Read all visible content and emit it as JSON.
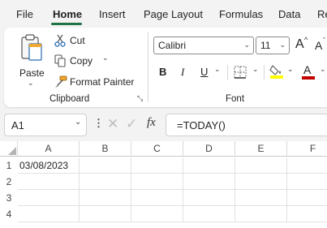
{
  "tabs": [
    "File",
    "Home",
    "Insert",
    "Page Layout",
    "Formulas",
    "Data",
    "Re"
  ],
  "active_tab": "Home",
  "clipboard": {
    "paste_label": "Paste",
    "cut_label": "Cut",
    "copy_label": "Copy",
    "format_painter_label": "Format Painter",
    "group_label": "Clipboard"
  },
  "font": {
    "name": "Calibri",
    "size": "11",
    "group_label": "Font",
    "bold": "B",
    "italic": "I",
    "underline": "U",
    "grow": "A",
    "shrink": "A",
    "font_color_letter": "A",
    "highlight_color": "#ffff00",
    "font_color": "#c00000"
  },
  "formula_bar": {
    "name_box": "A1",
    "fx": "fx",
    "formula": "=TODAY()"
  },
  "sheet": {
    "columns": [
      "A",
      "B",
      "C",
      "D",
      "E",
      "F"
    ],
    "rows": [
      "1",
      "2",
      "3",
      "4"
    ],
    "cells": {
      "A1": "03/08/2023"
    }
  },
  "colors": {
    "accent": "#217346"
  }
}
